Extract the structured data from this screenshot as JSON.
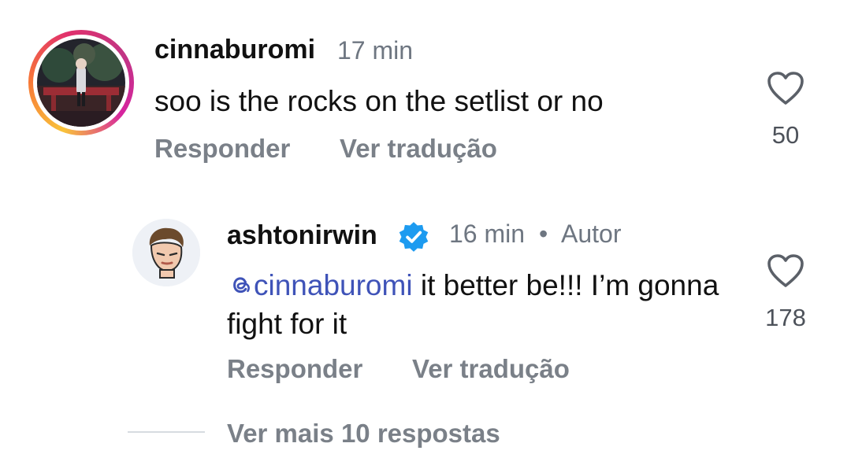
{
  "comment1": {
    "username": "cinnaburomi",
    "time": "17 min",
    "text": "soo is the rocks on the setlist or no",
    "actions": {
      "reply": "Responder",
      "translate": "Ver tradução"
    },
    "likes": "50",
    "avatar": "profile-photo-outdoor-night",
    "has_story_ring": true
  },
  "reply1": {
    "username": "ashtonirwin",
    "verified": true,
    "time": "16 min",
    "separator": "•",
    "author_badge": "Autor",
    "mention_icon": "threads-icon",
    "mention": "cinnaburomi",
    "text": " it better be!!! I’m gonna fight for it",
    "actions": {
      "reply": "Responder",
      "translate": "Ver tradução"
    },
    "likes": "178",
    "avatar": "profile-face-sticker"
  },
  "more_replies": "Ver mais 10 respostas",
  "colors": {
    "verified_badge": "#1d9bf0",
    "mention": "#3f53b8",
    "muted_text": "#7a8088"
  }
}
